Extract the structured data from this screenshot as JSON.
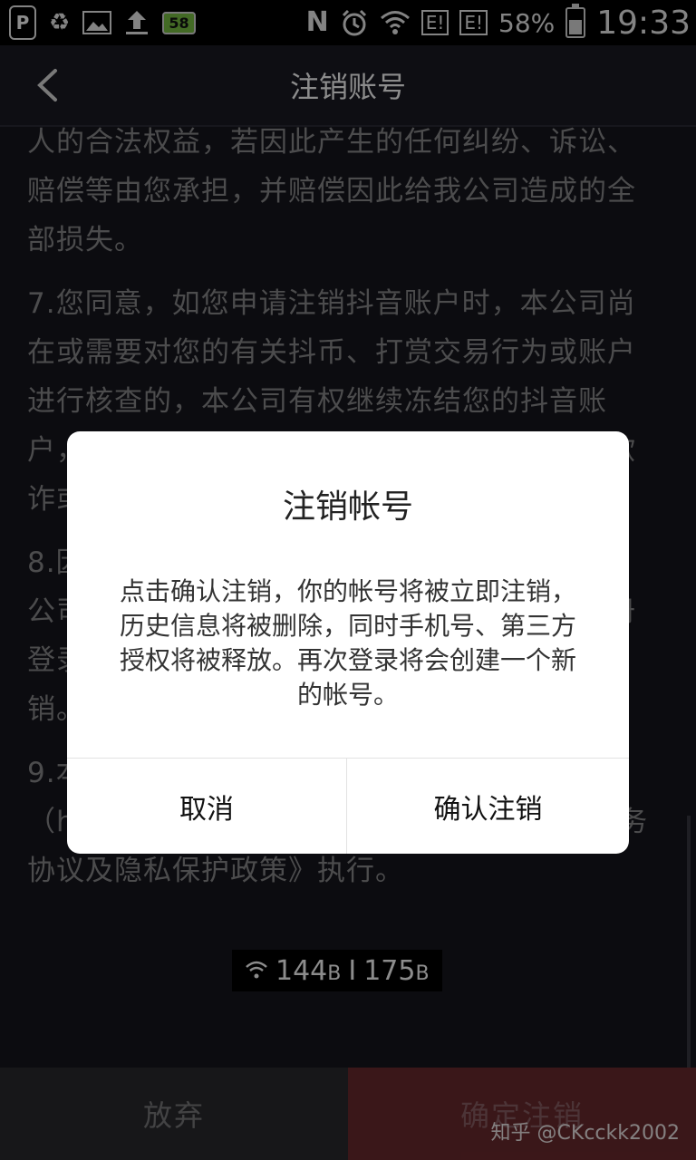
{
  "status_bar": {
    "p_badge": "P",
    "battery_badge": "58",
    "n_label": "N",
    "sim1": "E!",
    "sim2": "E!",
    "battery_percent": "58%",
    "battery_level": 0.58,
    "time": "19:33"
  },
  "nav": {
    "title": "注销账号"
  },
  "content": {
    "paragraphs": [
      "人的合法权益，若因此产生的任何纠纷、诉讼、赔偿等由您承担，并赔偿因此给我公司造成的全部损失。",
      "7.您同意，如您申请注销抖音账户时，本公司尚在或需要对您的有关抖币、打赏交易行为或账户进行核查的，本公司有权继续冻结您的抖音账户，直至核查完毕。若经核查，您的行为涉嫌欺诈或违法的，本公司有权依法处理。",
      "8.因您注销帐号造成的一切后果由您自行承担，公司账户注销后，您将无法使用原账户信息注册登录及使用抖音的服务，请您谨慎操作账户注销。",
      "9.本协议未约定的内容，按照抖音官网（https://www.douyin.com）上的《用户服务协议及隐私保护政策》执行。"
    ]
  },
  "net_speed": {
    "down": "144",
    "down_unit": "B",
    "separator": "I",
    "up": "175",
    "up_unit": "B"
  },
  "bottom": {
    "abandon_label": "放弃",
    "confirm_label": "确定注销"
  },
  "watermark": "知乎 @CKcckk2002",
  "dialog": {
    "title": "注销帐号",
    "message": "点击确认注销，你的帐号将被立即注销，历史信息将被删除，同时手机号、第三方授权将被释放。再次登录将会创建一个新的帐号。",
    "cancel_label": "取消",
    "confirm_label": "确认注销"
  },
  "colors": {
    "confirm_bar": "#6b2a2e",
    "abandon_bar": "#2a2a2e",
    "background": "#16161e"
  }
}
